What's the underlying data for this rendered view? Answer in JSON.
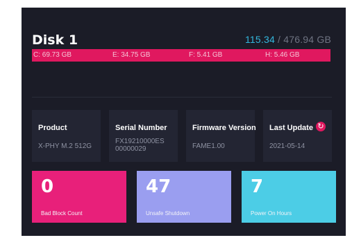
{
  "disk": {
    "title": "Disk 1",
    "used": "115.34",
    "separator": " / ",
    "total": "476.94 GB",
    "bar_color": "#e0185f"
  },
  "partitions": [
    {
      "label": "C: 69.73 GB"
    },
    {
      "label": "E: 34.75 GB"
    },
    {
      "label": "F: 5.41 GB"
    },
    {
      "label": "H: 5.46 GB"
    }
  ],
  "info_cards": [
    {
      "label": "Product",
      "value": "X-PHY M.2 512G"
    },
    {
      "label": "Serial Number",
      "value": "FX19210000ES\n00000029"
    },
    {
      "label": "Firmware Version",
      "value": "FAME1.00"
    },
    {
      "label": "Last Update",
      "value": "2021-05-14",
      "icon": "refresh-icon"
    }
  ],
  "stats": [
    {
      "value": "0",
      "label": "Bad Block Count",
      "color": "#e8207a"
    },
    {
      "value": "47",
      "label": "Unsafe Shutdown",
      "color": "#9a9ef0"
    },
    {
      "value": "7",
      "label": "Power On Hours",
      "color": "#4ccde6"
    }
  ]
}
